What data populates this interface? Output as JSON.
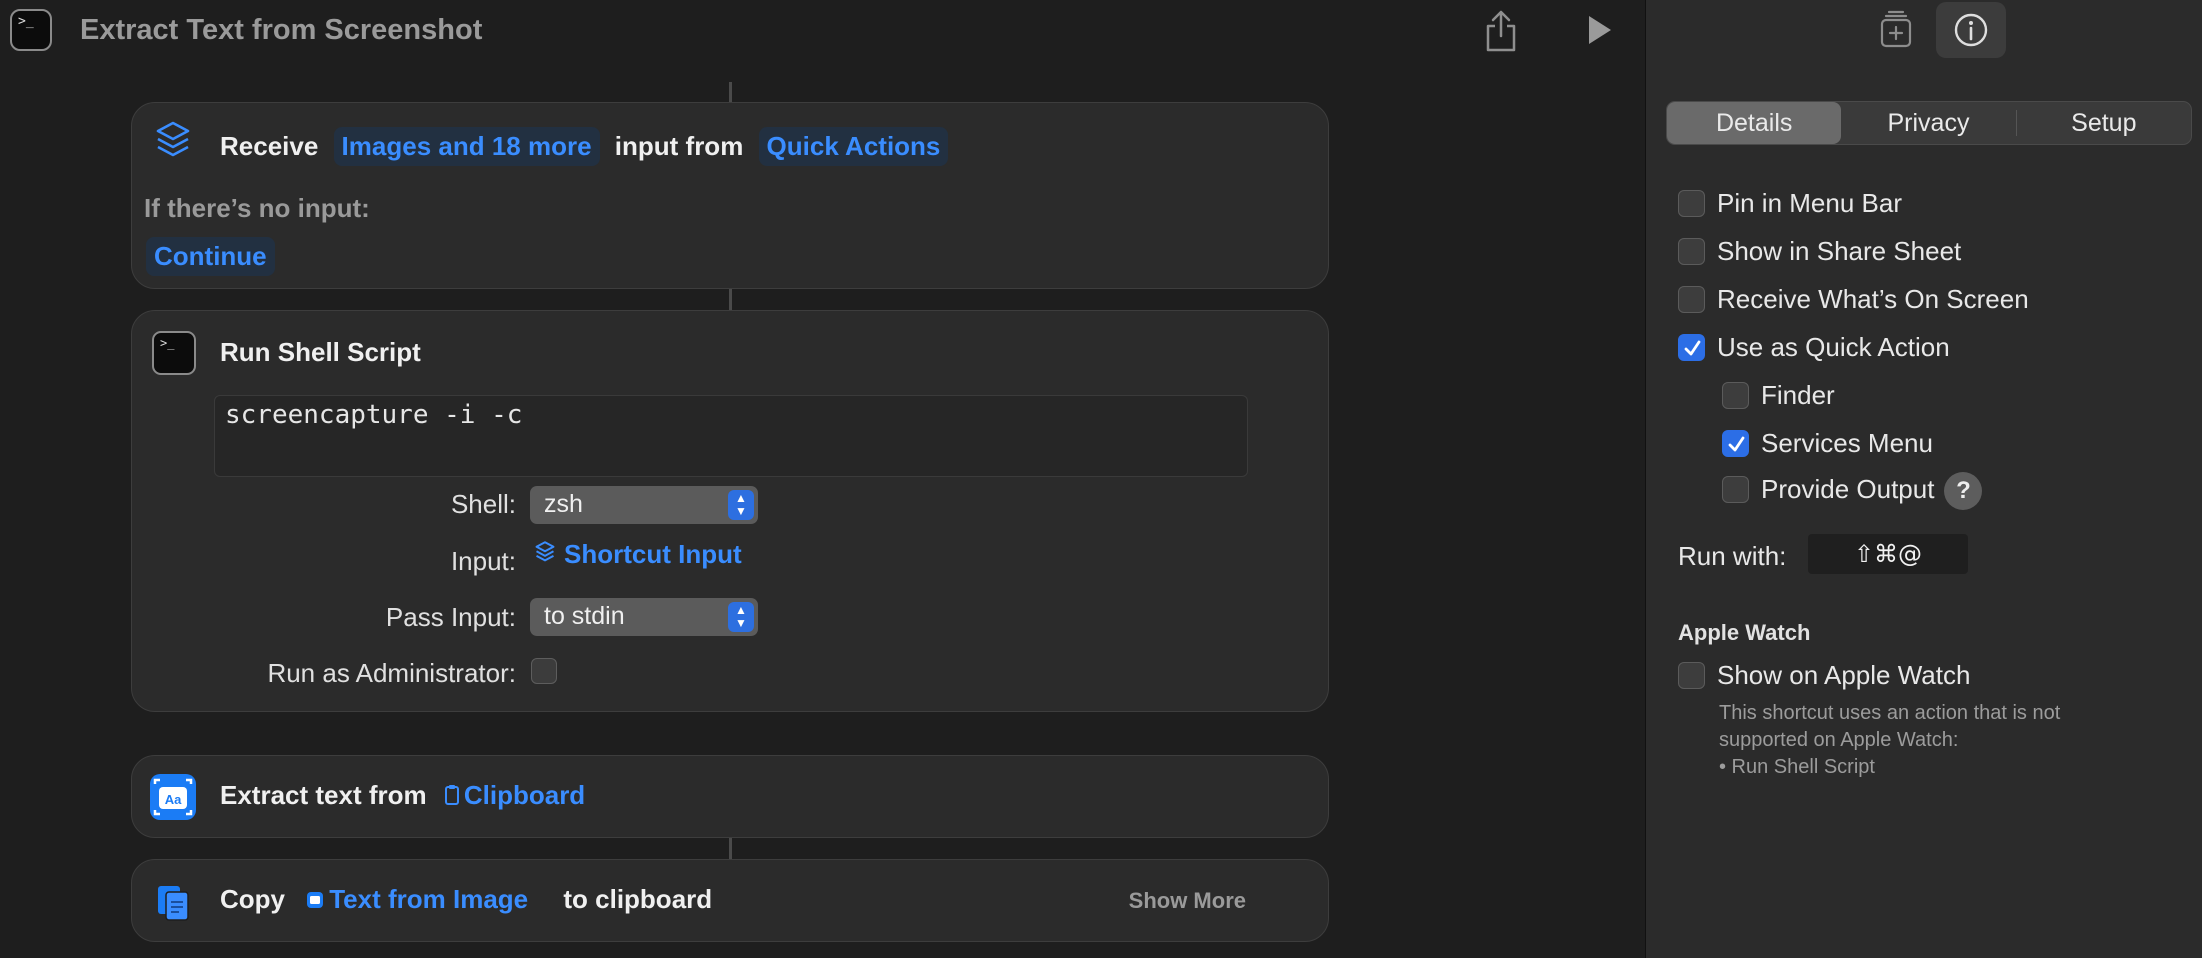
{
  "window": {
    "title": "Extract Text from Screenshot"
  },
  "actions": {
    "receive": {
      "label": "Receive",
      "types": "Images and 18 more",
      "input_from": "input from",
      "source": "Quick Actions",
      "no_input_label": "If there’s no input:",
      "no_input_value": "Continue"
    },
    "shell": {
      "title": "Run Shell Script",
      "script": "screencapture -i -c",
      "shell_label": "Shell:",
      "shell_value": "zsh",
      "input_label": "Input:",
      "input_value": "Shortcut Input",
      "pass_label": "Pass Input:",
      "pass_value": "to stdin",
      "admin_label": "Run as Administrator:",
      "admin_checked": false
    },
    "extract": {
      "label": "Extract text from",
      "source": "Clipboard"
    },
    "copy": {
      "label": "Copy",
      "value": "Text from Image",
      "suffix": "to clipboard",
      "show_more": "Show More"
    }
  },
  "inspector": {
    "tabs": [
      {
        "label": "Details",
        "active": true
      },
      {
        "label": "Privacy",
        "active": false
      },
      {
        "label": "Setup",
        "active": false
      }
    ],
    "options": {
      "pin_menu_bar": {
        "label": "Pin in Menu Bar",
        "checked": false
      },
      "share_sheet": {
        "label": "Show in Share Sheet",
        "checked": false
      },
      "whats_on_screen": {
        "label": "Receive What’s On Screen",
        "checked": false
      },
      "quick_action": {
        "label": "Use as Quick Action",
        "checked": true
      },
      "finder": {
        "label": "Finder",
        "checked": false
      },
      "services_menu": {
        "label": "Services Menu",
        "checked": true
      },
      "provide_output": {
        "label": "Provide Output",
        "checked": false
      }
    },
    "help": "?",
    "run_with_label": "Run with:",
    "hotkey": "⇧⌘@",
    "watch": {
      "heading": "Apple Watch",
      "show_label": "Show on Apple Watch",
      "show_checked": false,
      "note_line1": "This shortcut uses an action that is not",
      "note_line2": "supported on Apple Watch:",
      "note_line3": "• Run Shell Script"
    }
  },
  "colors": {
    "accent": "#3a8dff",
    "checkbox_on": "#2c6ee6",
    "background": "#1e1e1e",
    "panel": "#2b2b2b"
  }
}
